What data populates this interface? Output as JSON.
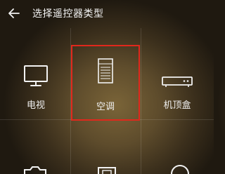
{
  "header": {
    "back_icon": "arrow-left-icon",
    "title": "选择遥控器类型"
  },
  "device_types": [
    {
      "label": "电视",
      "icon": "tv-icon"
    },
    {
      "label": "空调",
      "icon": "air-conditioner-icon",
      "selected": true
    },
    {
      "label": "机顶盒",
      "icon": "set-top-box-icon"
    }
  ],
  "next_row_icons": [
    "camera-icon",
    "projector-icon",
    "fan-icon"
  ],
  "colors": {
    "selection_border": "#e0281c",
    "background_center": "#7a6438",
    "background_edge": "#1f1910",
    "text": "#f2f2f2"
  }
}
